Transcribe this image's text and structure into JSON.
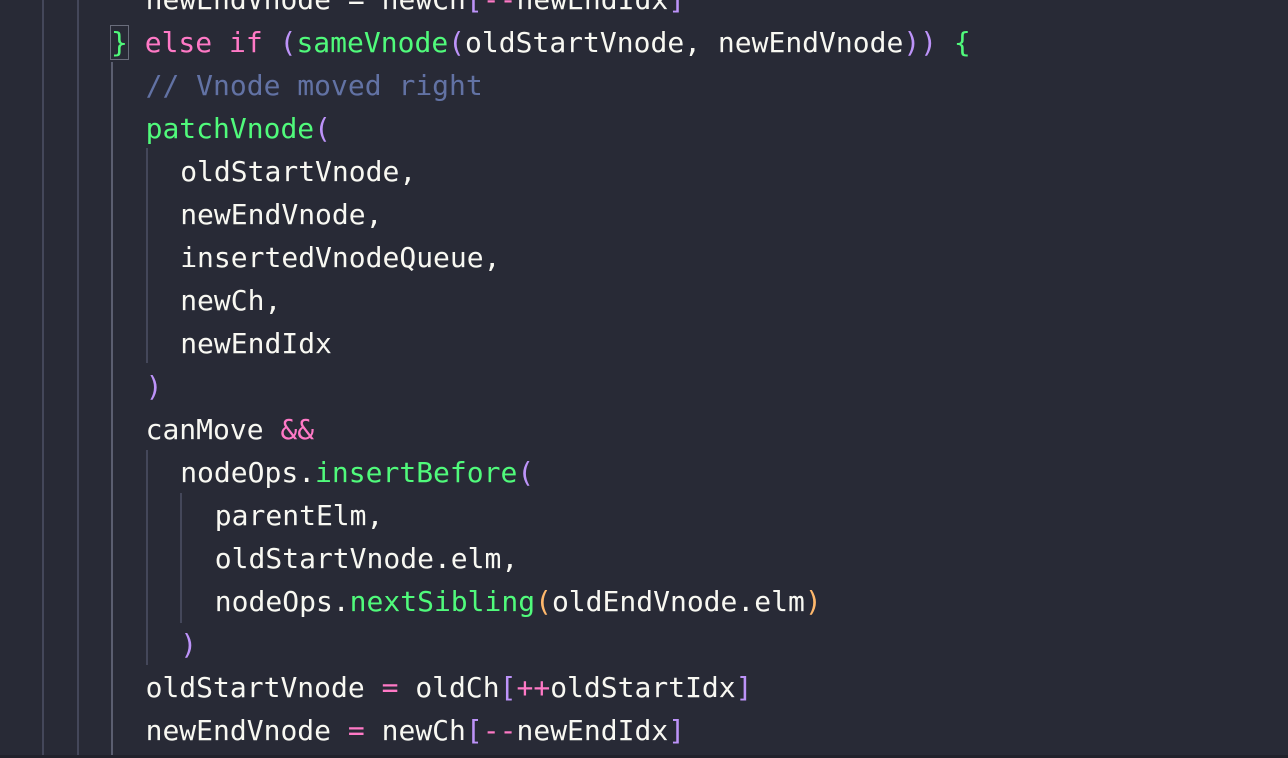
{
  "editor": {
    "theme_colors": {
      "background": "#282a36",
      "foreground": "#f8f8f2",
      "keyword": "#ff79c6",
      "function": "#50fa7b",
      "comment": "#6272a4",
      "bracket_level_1": "#bd93f9",
      "bracket_level_2": "#ffb86c",
      "indent_guide": "#44475a"
    },
    "lines": [
      {
        "indent": 1,
        "tokens": [
          {
            "t": "newEndVnode = newCh",
            "c": "plain"
          },
          {
            "t": "[",
            "c": "p1"
          },
          {
            "t": "--",
            "c": "op"
          },
          {
            "t": "newEndIdx",
            "c": "plain"
          },
          {
            "t": "]",
            "c": "p1"
          }
        ]
      },
      {
        "indent": 0,
        "tokens": [
          {
            "t": "}",
            "c": "brace",
            "match": true
          },
          {
            "t": " ",
            "c": "plain"
          },
          {
            "t": "else",
            "c": "kw"
          },
          {
            "t": " ",
            "c": "plain"
          },
          {
            "t": "if",
            "c": "kw"
          },
          {
            "t": " ",
            "c": "plain"
          },
          {
            "t": "(",
            "c": "p1"
          },
          {
            "t": "sameVnode",
            "c": "fn"
          },
          {
            "t": "(",
            "c": "p1"
          },
          {
            "t": "oldStartVnode, newEndVnode",
            "c": "plain"
          },
          {
            "t": "))",
            "c": "p1"
          },
          {
            "t": " ",
            "c": "plain"
          },
          {
            "t": "{",
            "c": "brace"
          }
        ]
      },
      {
        "indent": 1,
        "tokens": [
          {
            "t": "// Vnode moved right",
            "c": "cm"
          }
        ]
      },
      {
        "indent": 1,
        "tokens": [
          {
            "t": "patchVnode",
            "c": "fn"
          },
          {
            "t": "(",
            "c": "p1"
          }
        ]
      },
      {
        "indent": 2,
        "tokens": [
          {
            "t": "oldStartVnode,",
            "c": "plain"
          }
        ]
      },
      {
        "indent": 2,
        "tokens": [
          {
            "t": "newEndVnode,",
            "c": "plain"
          }
        ]
      },
      {
        "indent": 2,
        "tokens": [
          {
            "t": "insertedVnodeQueue,",
            "c": "plain"
          }
        ]
      },
      {
        "indent": 2,
        "tokens": [
          {
            "t": "newCh,",
            "c": "plain"
          }
        ]
      },
      {
        "indent": 2,
        "tokens": [
          {
            "t": "newEndIdx",
            "c": "plain"
          }
        ]
      },
      {
        "indent": 1,
        "tokens": [
          {
            "t": ")",
            "c": "p1"
          }
        ]
      },
      {
        "indent": 1,
        "tokens": [
          {
            "t": "canMove ",
            "c": "plain"
          },
          {
            "t": "&&",
            "c": "op"
          }
        ]
      },
      {
        "indent": 2,
        "tokens": [
          {
            "t": "nodeOps.",
            "c": "plain"
          },
          {
            "t": "insertBefore",
            "c": "fn"
          },
          {
            "t": "(",
            "c": "p1"
          }
        ]
      },
      {
        "indent": 3,
        "tokens": [
          {
            "t": "parentElm,",
            "c": "plain"
          }
        ]
      },
      {
        "indent": 3,
        "tokens": [
          {
            "t": "oldStartVnode.elm,",
            "c": "plain"
          }
        ]
      },
      {
        "indent": 3,
        "tokens": [
          {
            "t": "nodeOps.",
            "c": "plain"
          },
          {
            "t": "nextSibling",
            "c": "fn"
          },
          {
            "t": "(",
            "c": "p2"
          },
          {
            "t": "oldEndVnode.elm",
            "c": "plain"
          },
          {
            "t": ")",
            "c": "p2"
          }
        ]
      },
      {
        "indent": 2,
        "tokens": [
          {
            "t": ")",
            "c": "p1"
          }
        ]
      },
      {
        "indent": 1,
        "tokens": [
          {
            "t": "oldStartVnode ",
            "c": "plain"
          },
          {
            "t": "=",
            "c": "op"
          },
          {
            "t": " oldCh",
            "c": "plain"
          },
          {
            "t": "[",
            "c": "p1"
          },
          {
            "t": "++",
            "c": "op"
          },
          {
            "t": "oldStartIdx",
            "c": "plain"
          },
          {
            "t": "]",
            "c": "p1"
          }
        ]
      },
      {
        "indent": 1,
        "tokens": [
          {
            "t": "newEndVnode ",
            "c": "plain"
          },
          {
            "t": "=",
            "c": "op"
          },
          {
            "t": " newCh",
            "c": "plain"
          },
          {
            "t": "[",
            "c": "p1"
          },
          {
            "t": "--",
            "c": "op"
          },
          {
            "t": "newEndIdx",
            "c": "plain"
          },
          {
            "t": "]",
            "c": "p1"
          }
        ]
      }
    ]
  }
}
